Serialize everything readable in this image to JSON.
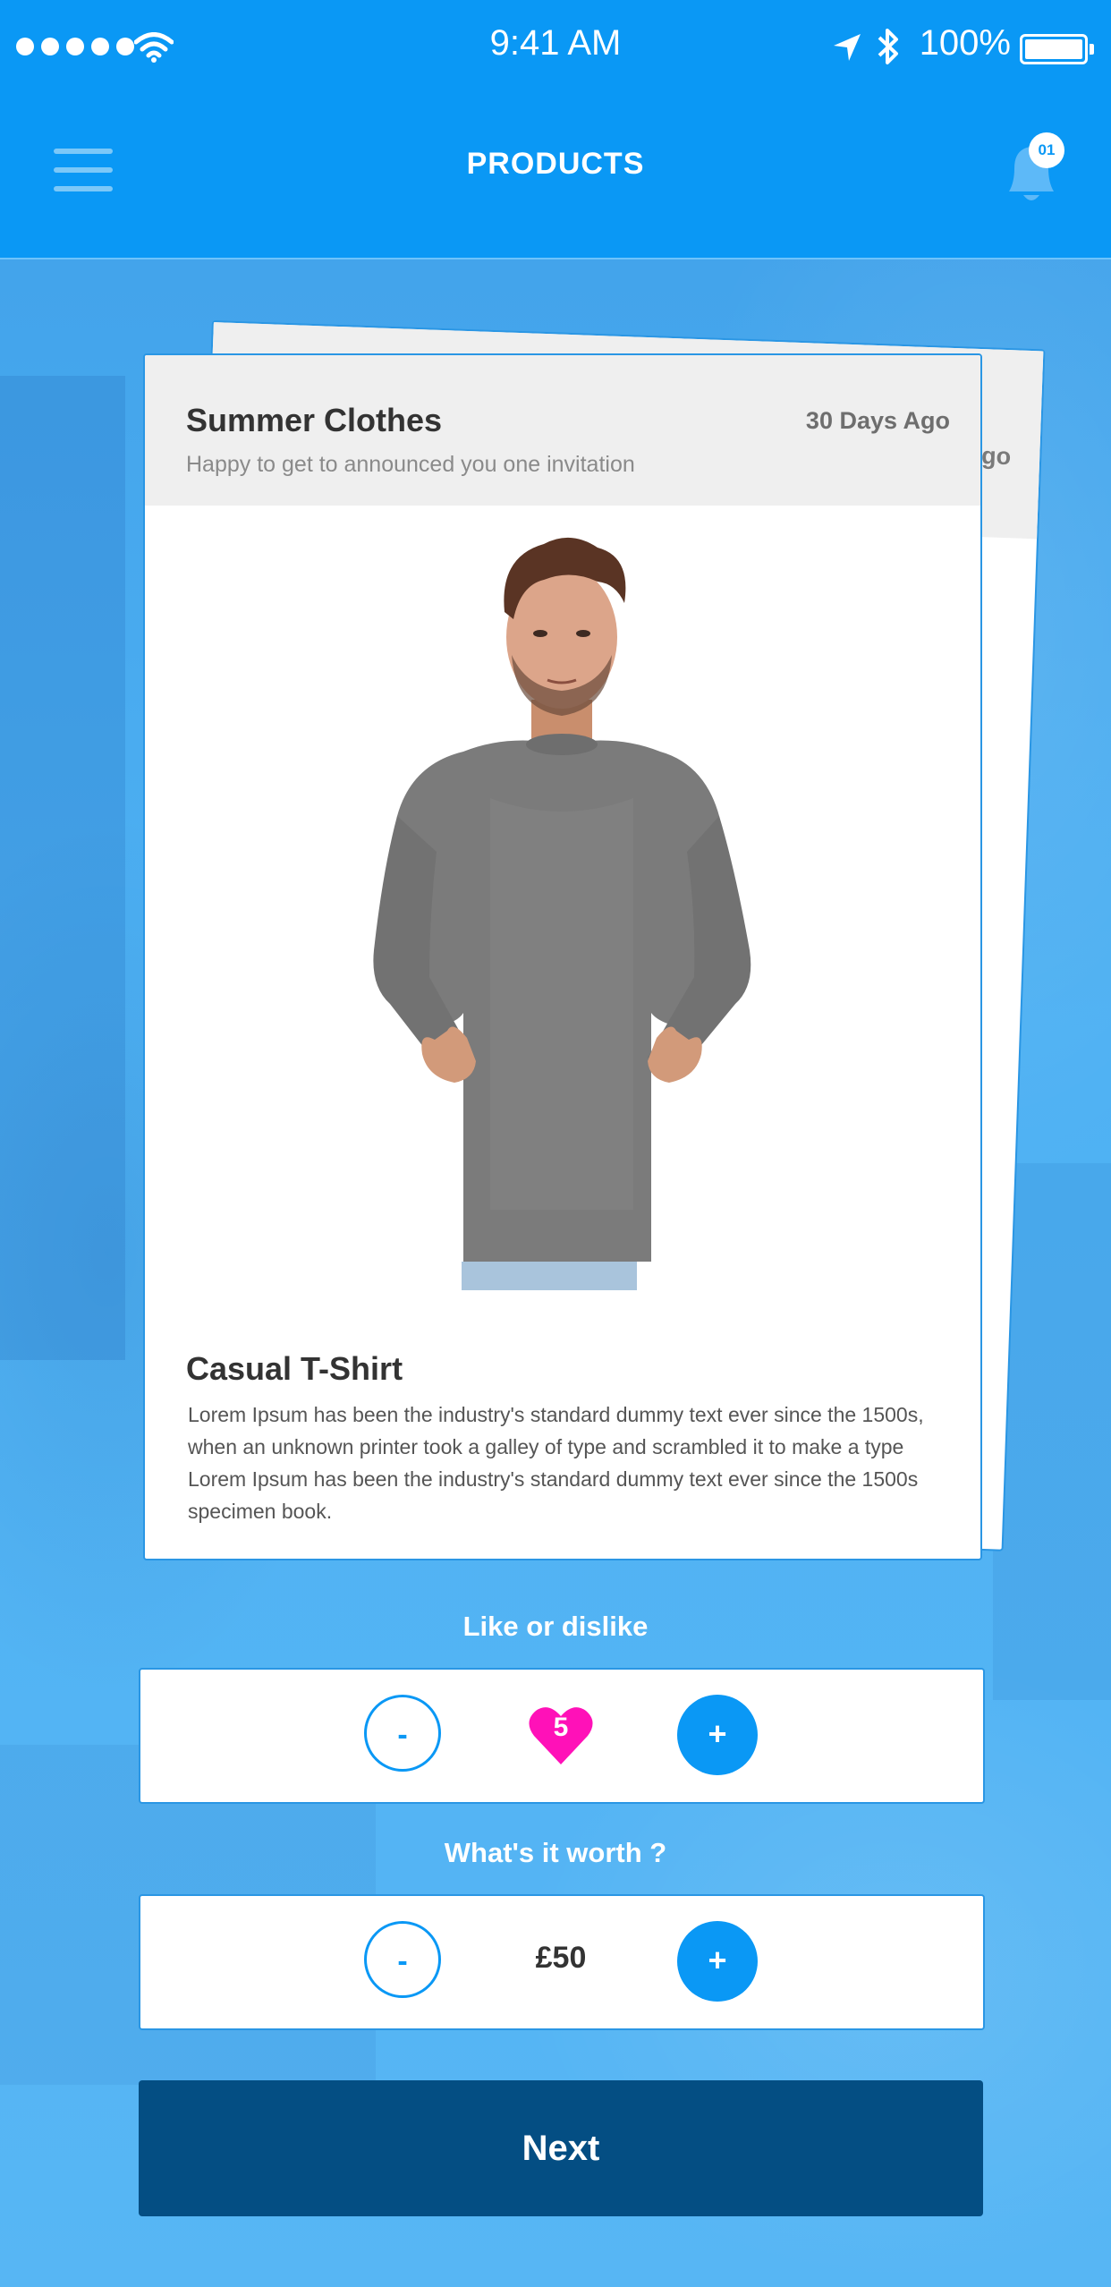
{
  "status_bar": {
    "time": "9:41 AM",
    "battery": "100%",
    "icons": [
      "signal-dots-icon",
      "wifi-icon",
      "location-arrow-icon",
      "bluetooth-icon",
      "battery-icon"
    ]
  },
  "header": {
    "title": "PRODUCTS",
    "notification_count": "01",
    "icons": [
      "menu-icon",
      "bell-icon"
    ]
  },
  "back_card": {
    "date": "30 Days Ago"
  },
  "card": {
    "title": "Summer Clothes",
    "date": "30 Days Ago",
    "subtitle": "Happy to get to announced you one invitation",
    "product_name": "Casual T-Shirt",
    "description": "Lorem Ipsum has been the industry's standard dummy text ever since the 1500s, when an unknown printer took a galley of type and scrambled it to make a type Lorem Ipsum has been the industry's standard dummy text ever since the 1500s specimen book."
  },
  "like": {
    "label": "Like or dislike",
    "minus": "-",
    "plus": "+",
    "count": "5"
  },
  "worth": {
    "label": "What's it worth ?",
    "minus": "-",
    "plus": "+",
    "value": "£50"
  },
  "next_label": "Next",
  "colors": {
    "primary": "#0a98f5",
    "dark_button": "#044e83",
    "heart": "#ff11b8",
    "background": "#4aaaf0"
  }
}
